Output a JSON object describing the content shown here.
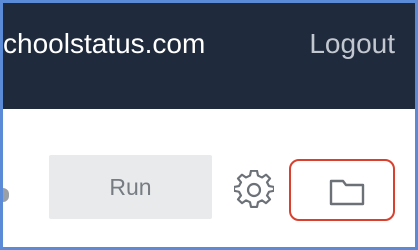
{
  "header": {
    "account_domain": "choolstatus.com",
    "logout_label": "Logout"
  },
  "toolbar": {
    "run_label": "Run",
    "settings_icon": "gear-icon",
    "folder_icon": "folder-icon"
  },
  "colors": {
    "header_bg": "#1f2a3c",
    "frame_border": "#5b8bd6",
    "highlight_border": "#d9402e",
    "button_bg": "#e8eaec"
  }
}
